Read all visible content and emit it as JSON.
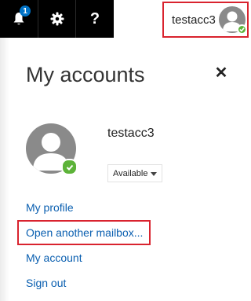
{
  "topbar": {
    "notification_count": "1",
    "help_label": "?",
    "username": "testacc3"
  },
  "panel": {
    "title": "My accounts",
    "close_label": "✕",
    "profile_name": "testacc3",
    "status": "Available",
    "links": {
      "my_profile": "My profile",
      "open_another_mailbox": "Open another mailbox...",
      "my_account": "My account",
      "sign_out": "Sign out"
    }
  },
  "colors": {
    "accent_link": "#0a5fb0",
    "highlight": "#d9232e",
    "presence": "#5db339",
    "badge": "#0072c6"
  },
  "icons": [
    "bell-icon",
    "gear-icon",
    "help-icon",
    "avatar",
    "presence-available-icon",
    "close-icon",
    "chevron-down-icon"
  ]
}
